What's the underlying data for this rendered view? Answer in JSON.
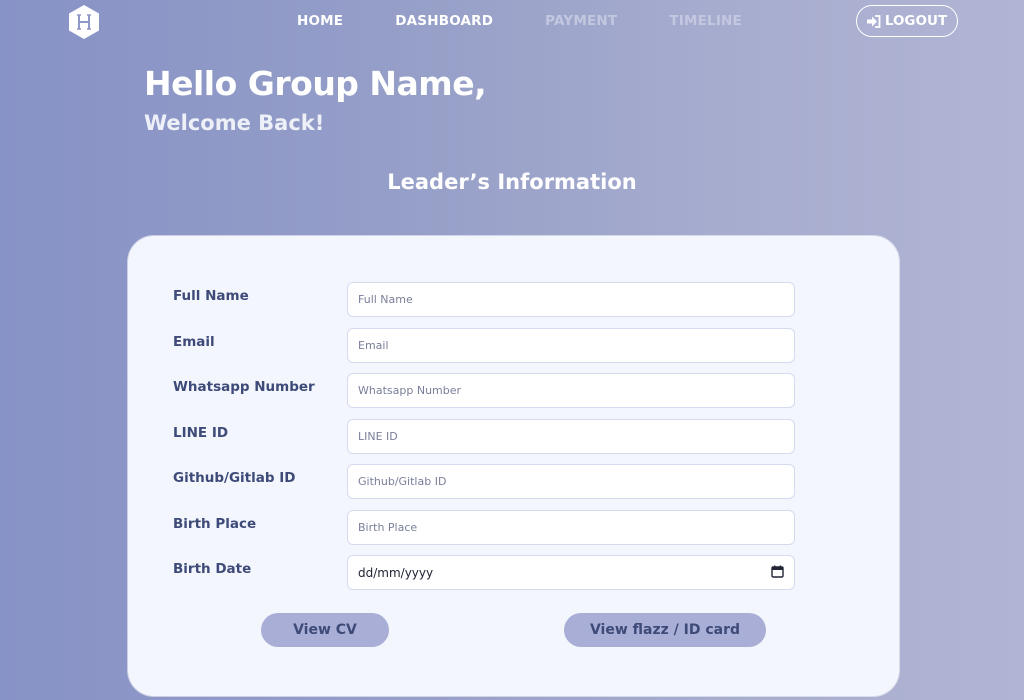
{
  "nav": {
    "items": [
      {
        "label": "HOME",
        "active": true
      },
      {
        "label": "DASHBOARD",
        "active": true
      },
      {
        "label": "PAYMENT",
        "active": false
      },
      {
        "label": "TIMELINE",
        "active": false
      }
    ],
    "logout_label": "LOGOUT",
    "logo_icon": "hexagon-h-logo-icon"
  },
  "header": {
    "greeting": "Hello Group Name,",
    "subtitle": "Welcome Back!"
  },
  "section_title": "Leader’s Information",
  "form": {
    "fields": [
      {
        "label": "Full Name",
        "placeholder": "Full Name",
        "value": ""
      },
      {
        "label": "Email",
        "placeholder": "Email",
        "value": ""
      },
      {
        "label": "Whatsapp Number",
        "placeholder": "Whatsapp Number",
        "value": ""
      },
      {
        "label": "LINE ID",
        "placeholder": "LINE ID",
        "value": ""
      },
      {
        "label": "Github/Gitlab ID",
        "placeholder": "Github/Gitlab ID",
        "value": ""
      },
      {
        "label": "Birth Place",
        "placeholder": "Birth Place",
        "value": ""
      }
    ],
    "birth_date": {
      "label": "Birth Date",
      "value": "dd/mm/yyyy",
      "icon": "calendar-icon"
    },
    "buttons": {
      "view_cv": "View CV",
      "view_id_card": "View flazz / ID card"
    }
  },
  "colors": {
    "card_bg": "#f3f6fd",
    "label_text": "#3e4a78",
    "button_bg": "#a8aed6",
    "muted_nav": "#c3c7e0"
  }
}
